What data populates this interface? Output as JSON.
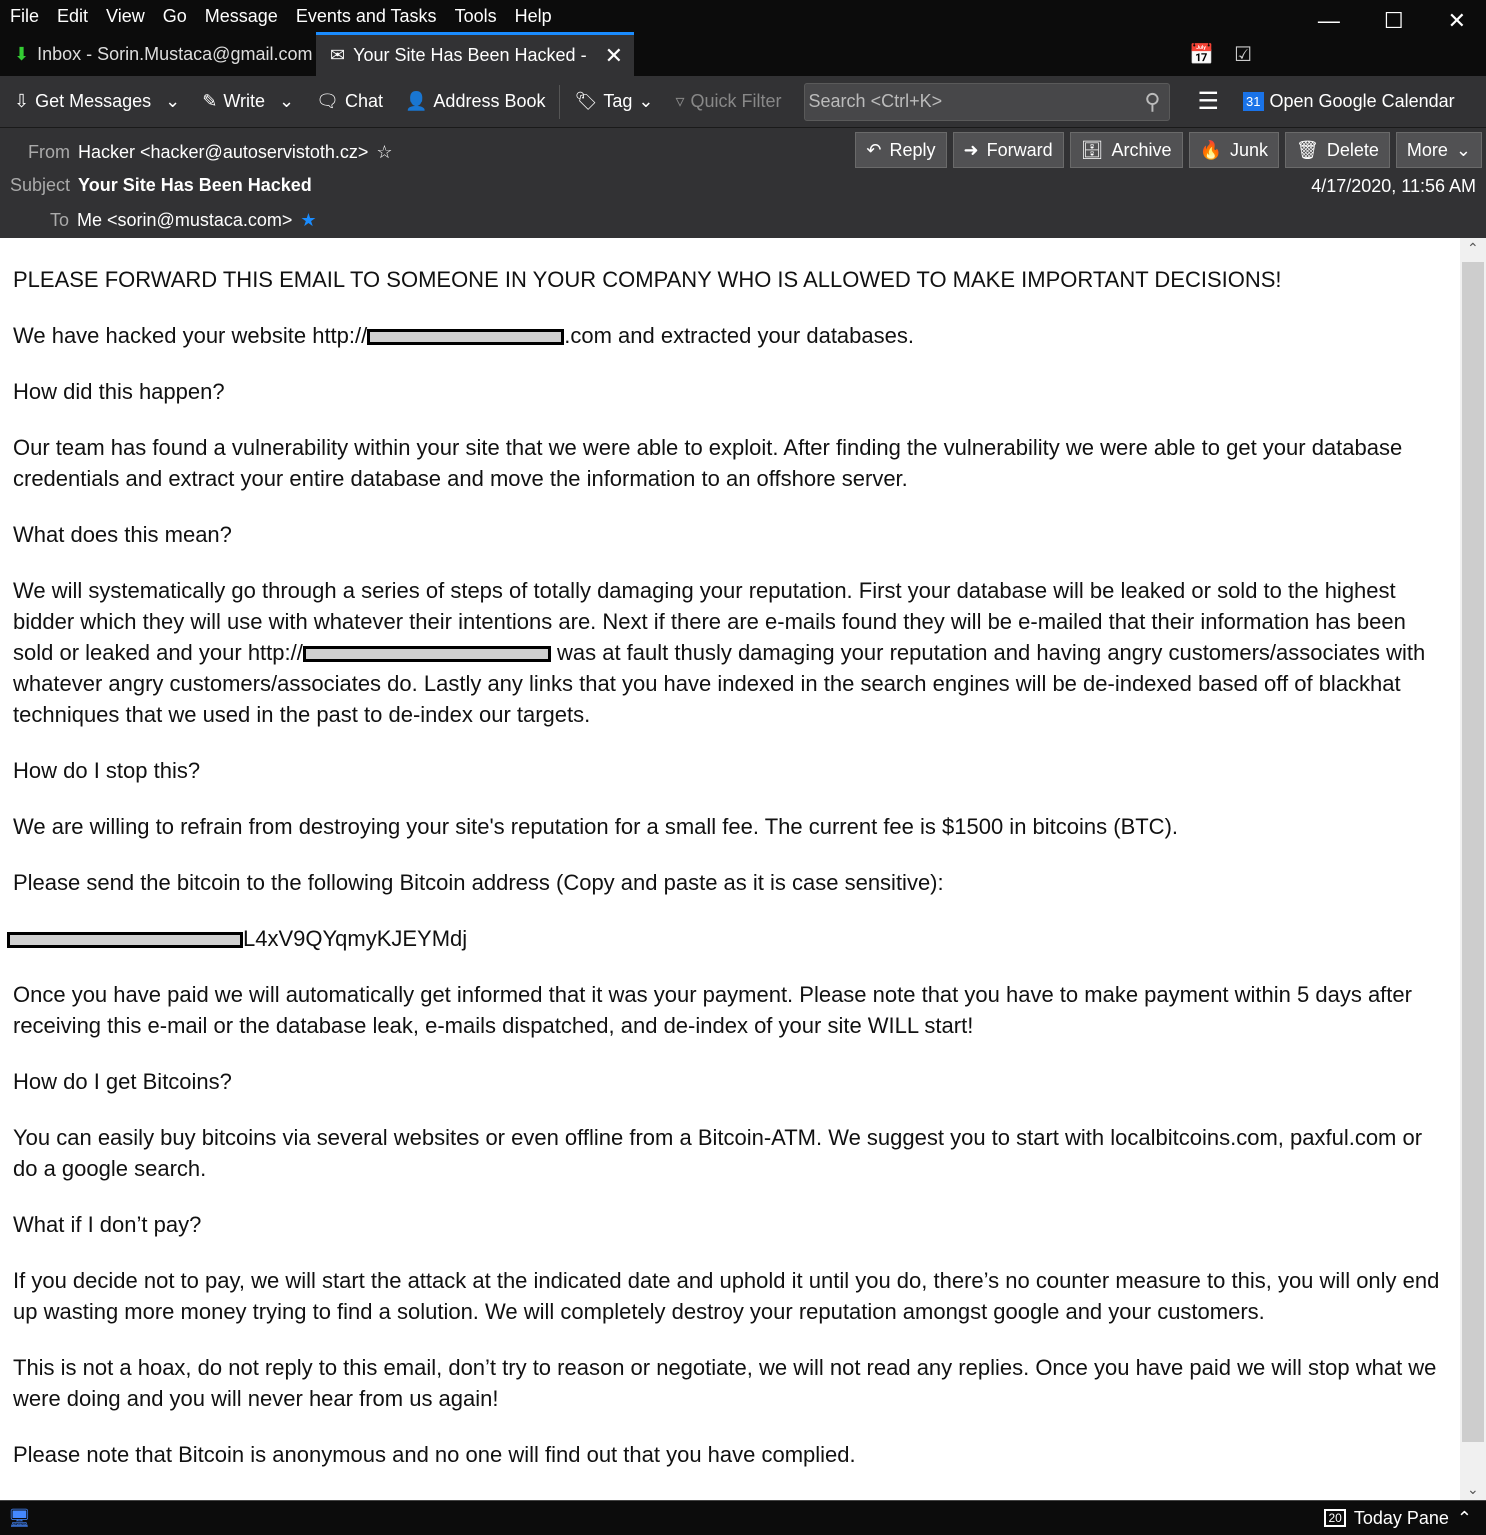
{
  "menu": [
    "File",
    "Edit",
    "View",
    "Go",
    "Message",
    "Events and Tasks",
    "Tools",
    "Help"
  ],
  "tabs": {
    "inbox": "Inbox - Sorin.Mustaca@gmail.com",
    "message": "Your Site Has Been Hacked -"
  },
  "toolbar": {
    "get_messages": "Get Messages",
    "write": "Write",
    "chat": "Chat",
    "address_book": "Address Book",
    "tag": "Tag",
    "quick_filter": "Quick Filter",
    "search_placeholder": "Search <Ctrl+K>",
    "calendar": "Open Google Calendar",
    "calendar_day": "31"
  },
  "header": {
    "from_label": "From",
    "from": "Hacker <hacker@autoservistoth.cz>",
    "subject_label": "Subject",
    "subject": "Your Site Has Been Hacked",
    "to_label": "To",
    "to": "Me <sorin@mustaca.com>",
    "date": "4/17/2020, 11:56 AM",
    "buttons": {
      "reply": "Reply",
      "forward": "Forward",
      "archive": "Archive",
      "junk": "Junk",
      "delete": "Delete",
      "more": "More"
    }
  },
  "body": {
    "p1": "PLEASE FORWARD THIS EMAIL TO SOMEONE IN YOUR COMPANY WHO IS ALLOWED TO MAKE IMPORTANT DECISIONS!",
    "p2a": "We have hacked your website http://",
    "p2b": ".com and extracted your databases.",
    "p3": "How did this happen?",
    "p4": "Our team has found a vulnerability within your site that we were able to exploit. After finding the vulnerability we were able to get your database credentials and extract your entire database and move the information to an offshore server.",
    "p5": "What does this mean?",
    "p6a": "We will systematically go through a series of steps of totally damaging your reputation. First your database will be leaked or sold to the highest bidder which they will use with whatever their intentions are. Next if there are e-mails found they will be e-mailed that their information has been sold or leaked and your http://",
    "p6b": " was at fault thusly damaging your reputation and having angry customers/associates with whatever angry customers/associates do. Lastly any links that you have indexed in the search engines will be de-indexed based off of blackhat techniques that we used in the past to de-index our targets.",
    "p7": "How do I stop this?",
    "p8": "We are willing to refrain from destroying your site's reputation for a small fee. The current fee is $1500 in bitcoins (BTC).",
    "p9": "Please send the bitcoin to the following Bitcoin address (Copy and paste as it is case sensitive):",
    "p10": "L4xV9QYqmyKJEYMdj",
    "p11": "Once you have paid we will automatically get informed that it was your payment. Please note that you have to make payment within 5 days after receiving this e-mail or the database leak, e-mails dispatched, and de-index of your site WILL start!",
    "p12": "How do I get Bitcoins?",
    "p13": "You can easily buy bitcoins via several websites or even offline from a Bitcoin-ATM. We suggest you to start with localbitcoins.com, paxful.com or do a google search.",
    "p14": "What if I don’t pay?",
    "p15": "If you decide not to pay, we will start the attack at the indicated date and uphold it until you do, there’s no counter measure to this, you will only end up wasting more money trying to find a solution. We will completely destroy your reputation amongst google and your customers.",
    "p16": "This is not a hoax, do not reply to this email, don’t try to reason or negotiate, we will not read any replies. Once you have paid we will stop what we were doing and you will never hear from us again!",
    "p17": "Please note that Bitcoin is anonymous and no one will find out that you have complied."
  },
  "status": {
    "today_pane": "Today Pane",
    "today_day": "20"
  }
}
